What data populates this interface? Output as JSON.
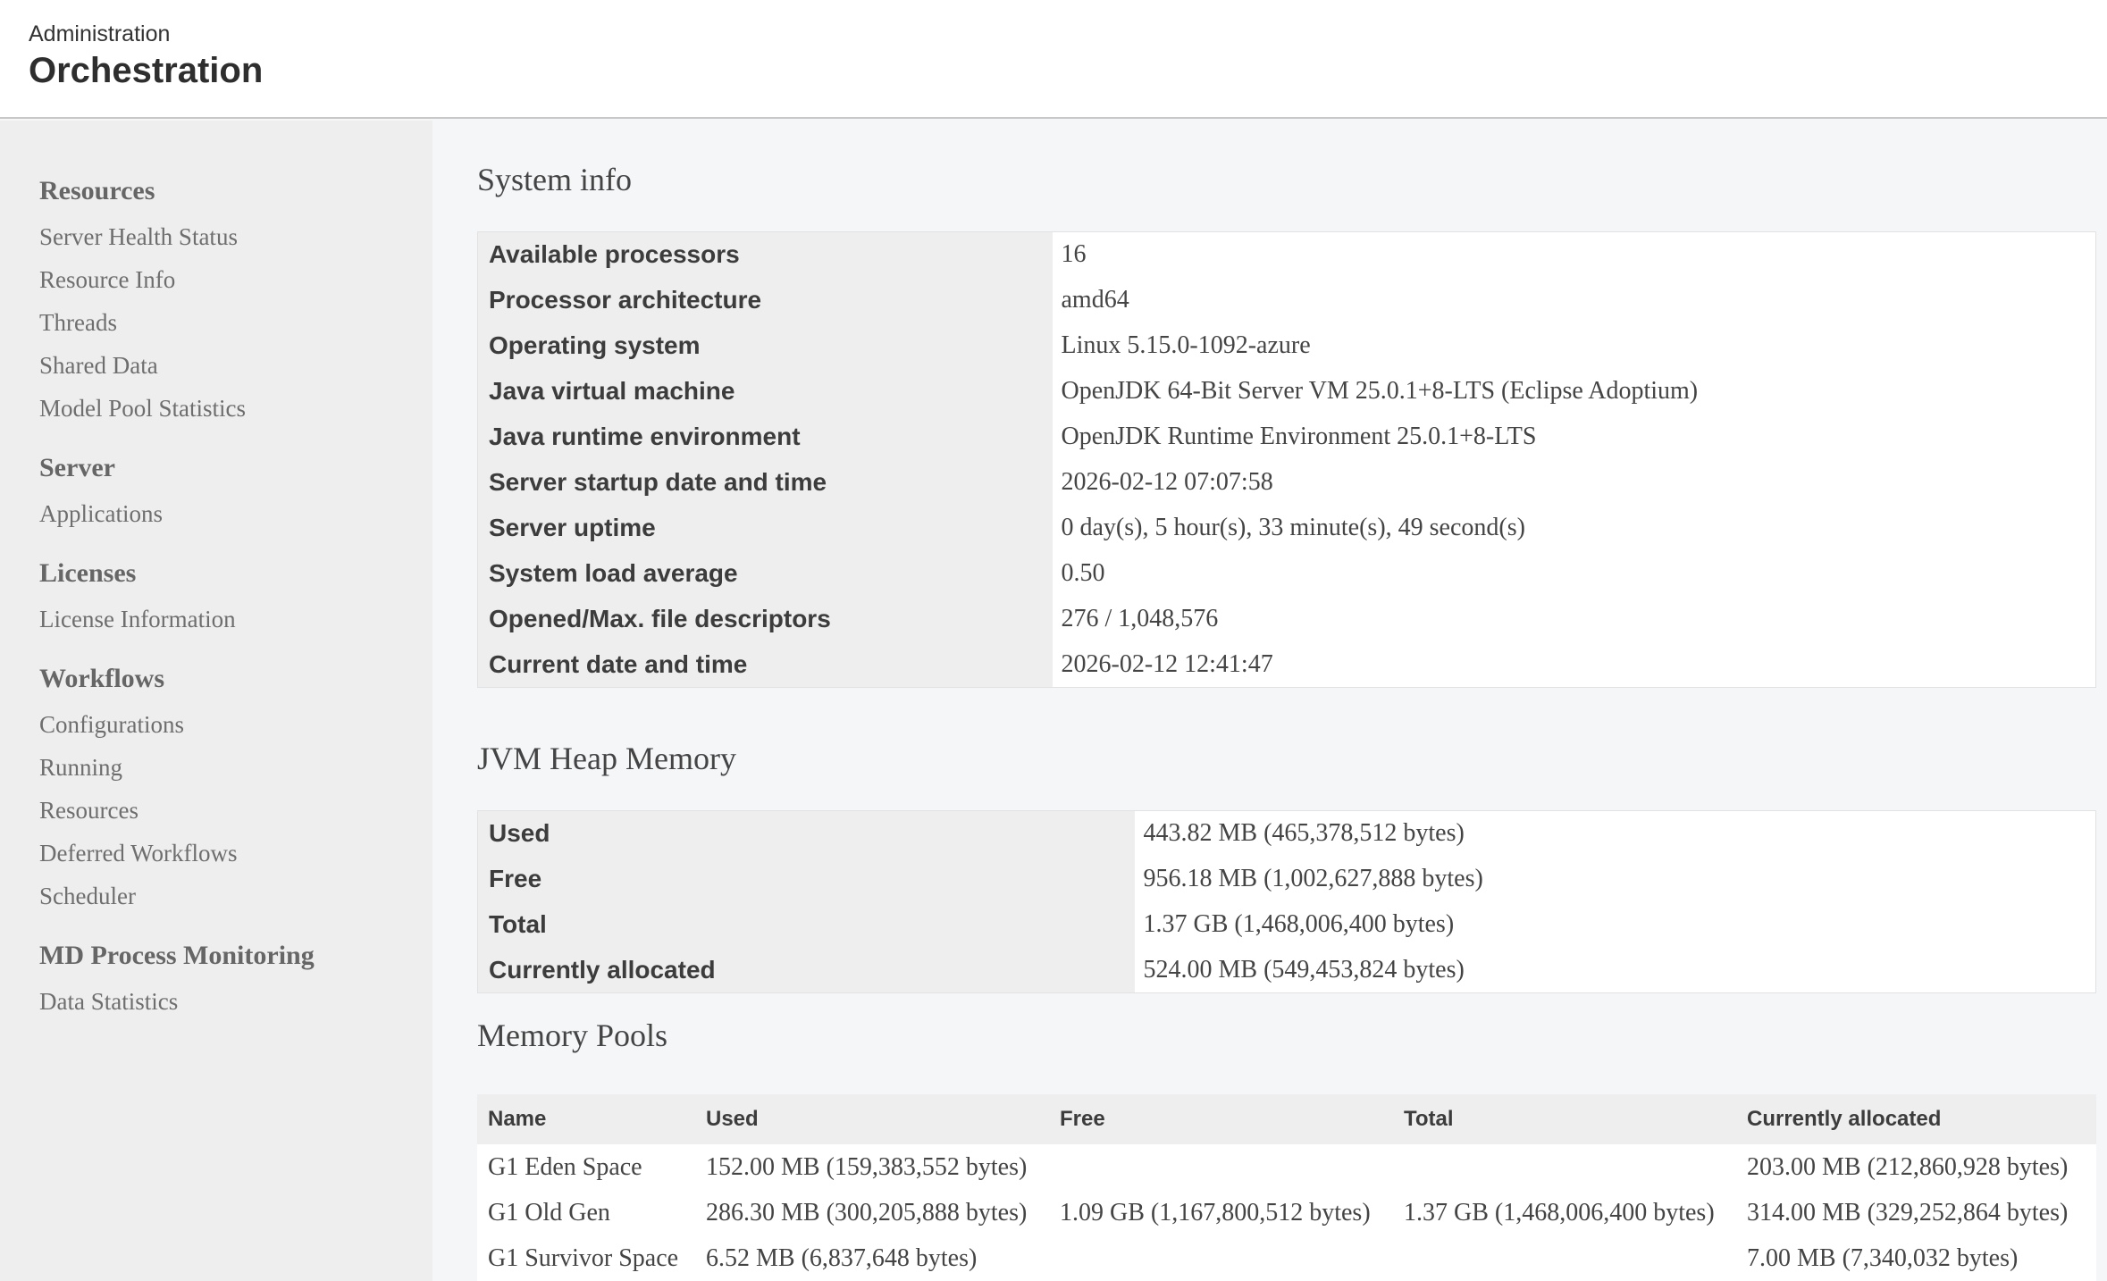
{
  "header": {
    "breadcrumb": "Administration",
    "title": "Orchestration"
  },
  "sidebar": {
    "groups": [
      {
        "label": "Resources",
        "items": [
          "Server Health Status",
          "Resource Info",
          "Threads",
          "Shared Data",
          "Model Pool Statistics"
        ]
      },
      {
        "label": "Server",
        "items": [
          "Applications"
        ]
      },
      {
        "label": "Licenses",
        "items": [
          "License Information"
        ]
      },
      {
        "label": "Workflows",
        "items": [
          "Configurations",
          "Running",
          "Resources",
          "Deferred Workflows",
          "Scheduler"
        ]
      },
      {
        "label": "MD Process Monitoring",
        "items": [
          "Data Statistics"
        ]
      }
    ]
  },
  "system_info": {
    "title": "System info",
    "rows": [
      {
        "key": "Available processors",
        "value": "16"
      },
      {
        "key": "Processor architecture",
        "value": "amd64"
      },
      {
        "key": "Operating system",
        "value": "Linux 5.15.0-1092-azure"
      },
      {
        "key": "Java virtual machine",
        "value": "OpenJDK 64-Bit Server VM 25.0.1+8-LTS (Eclipse Adoptium)"
      },
      {
        "key": "Java runtime environment",
        "value": "OpenJDK Runtime Environment 25.0.1+8-LTS"
      },
      {
        "key": "Server startup date and time",
        "value": "2026-02-12 07:07:58"
      },
      {
        "key": "Server uptime",
        "value": "0 day(s), 5 hour(s), 33 minute(s), 49 second(s)"
      },
      {
        "key": "System load average",
        "value": "0.50"
      },
      {
        "key": "Opened/Max. file descriptors",
        "value": "276 / 1,048,576"
      },
      {
        "key": "Current date and time",
        "value": "2026-02-12 12:41:47"
      }
    ]
  },
  "heap": {
    "title": "JVM Heap Memory",
    "rows": [
      {
        "key": "Used",
        "value": "443.82 MB (465,378,512 bytes)"
      },
      {
        "key": "Free",
        "value": "956.18 MB (1,002,627,888 bytes)"
      },
      {
        "key": "Total",
        "value": "1.37 GB (1,468,006,400 bytes)"
      },
      {
        "key": "Currently allocated",
        "value": "524.00 MB (549,453,824 bytes)"
      }
    ]
  },
  "pools": {
    "title": "Memory Pools",
    "columns": [
      "Name",
      "Used",
      "Free",
      "Total",
      "Currently allocated"
    ],
    "rows": [
      [
        "G1 Eden Space",
        "152.00 MB (159,383,552 bytes)",
        "",
        "",
        "203.00 MB (212,860,928 bytes)"
      ],
      [
        "G1 Old Gen",
        "286.30 MB (300,205,888 bytes)",
        "1.09 GB (1,167,800,512 bytes)",
        "1.37 GB (1,468,006,400 bytes)",
        "314.00 MB (329,252,864 bytes)"
      ],
      [
        "G1 Survivor Space",
        "6.52 MB (6,837,648 bytes)",
        "",
        "",
        "7.00 MB (7,340,032 bytes)"
      ]
    ]
  }
}
